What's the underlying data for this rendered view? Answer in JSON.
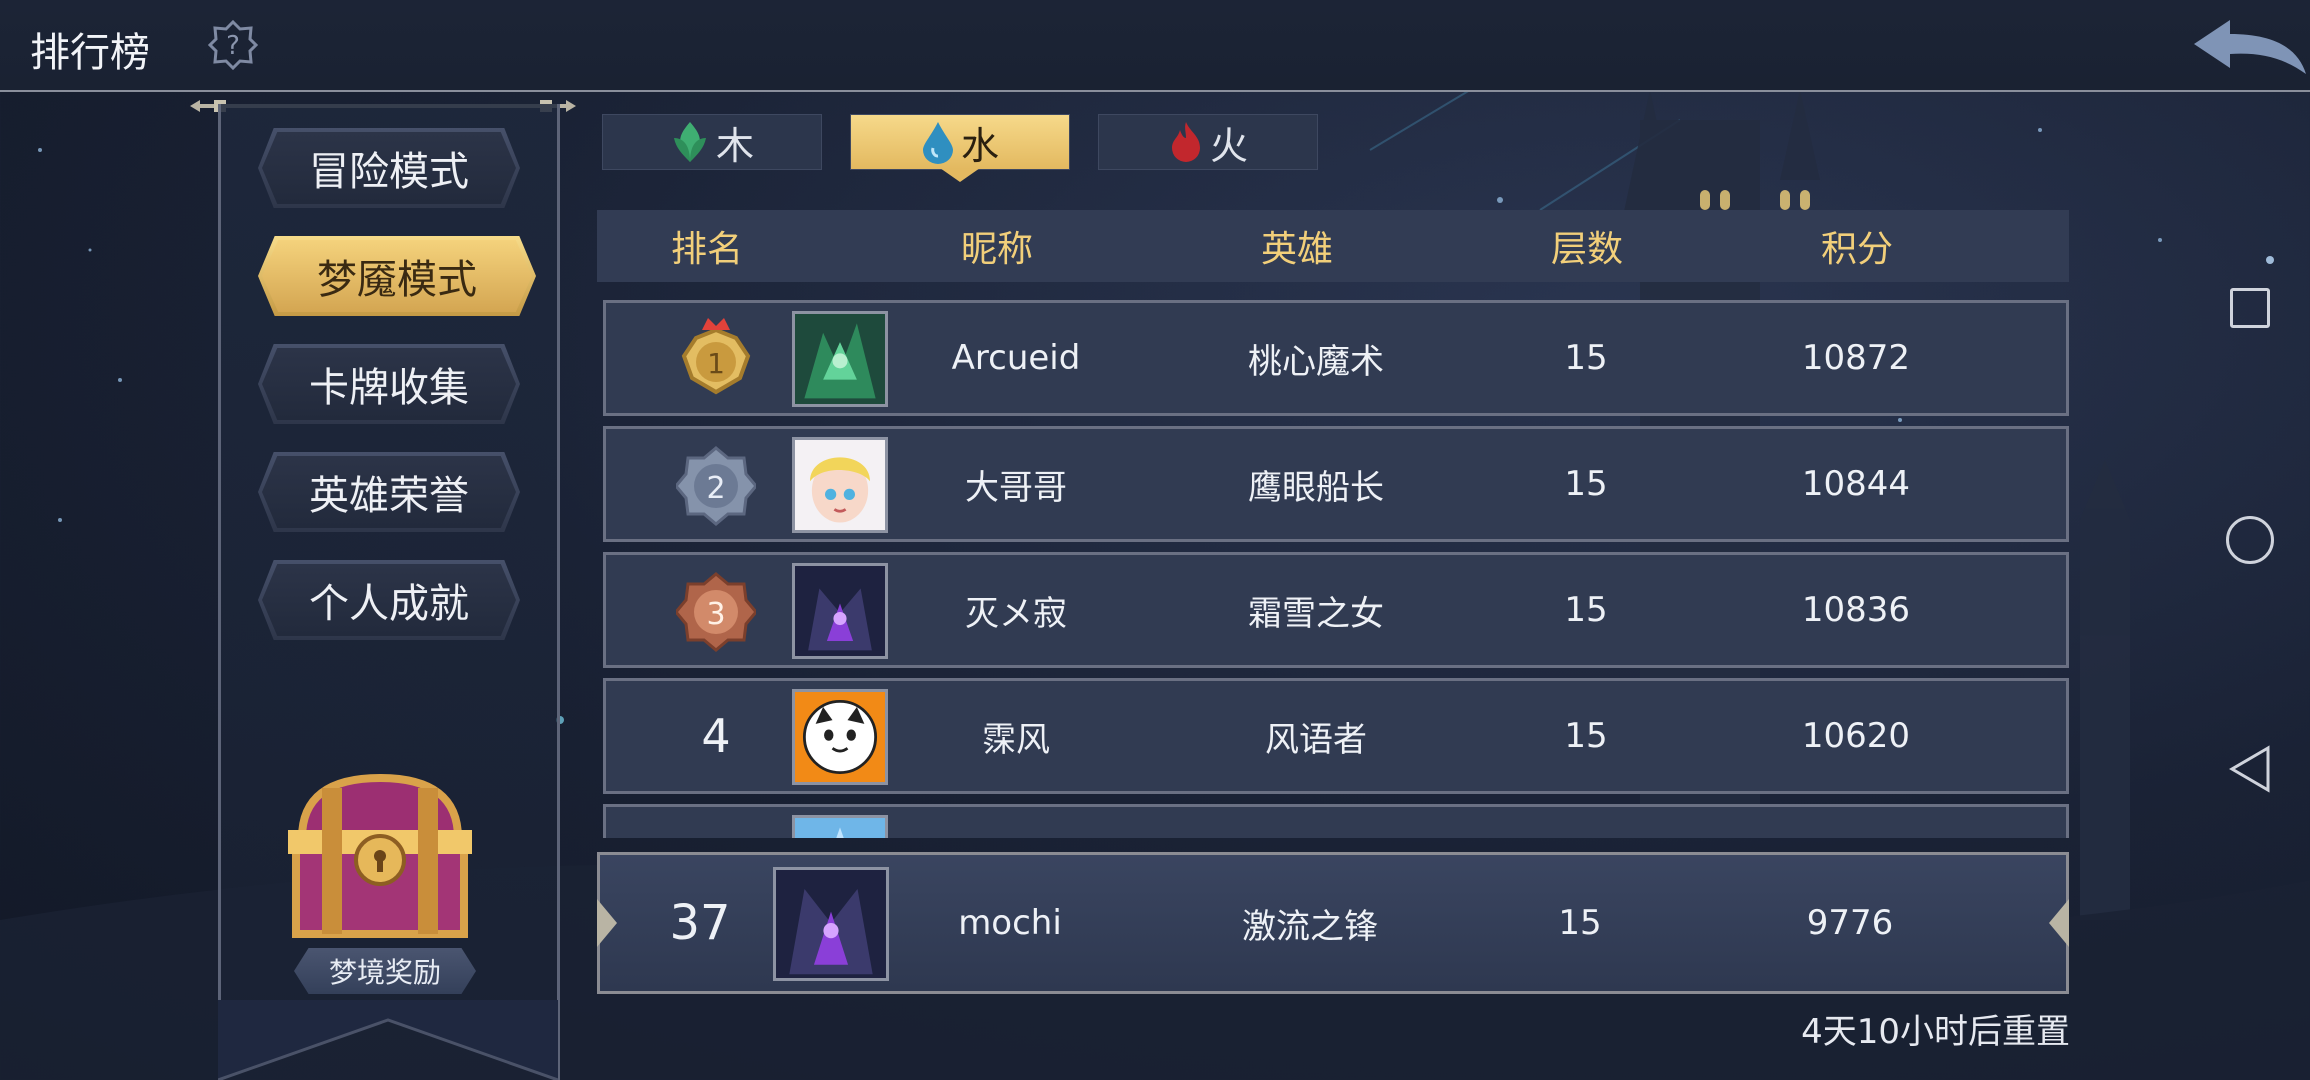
{
  "header": {
    "title": "排行榜"
  },
  "side_menu": {
    "items": [
      {
        "label": "冒险模式",
        "active": false
      },
      {
        "label": "梦魇模式",
        "active": true
      },
      {
        "label": "卡牌收集",
        "active": false
      },
      {
        "label": "英雄荣誉",
        "active": false
      },
      {
        "label": "个人成就",
        "active": false
      }
    ],
    "reward_label": "梦境奖励"
  },
  "tabs": [
    {
      "label": "木",
      "icon": "leaf-icon",
      "active": false
    },
    {
      "label": "水",
      "icon": "water-drop-icon",
      "active": true
    },
    {
      "label": "火",
      "icon": "fire-icon",
      "active": false
    }
  ],
  "table": {
    "headers": [
      "排名",
      "昵称",
      "英雄",
      "层数",
      "积分"
    ],
    "rows": [
      {
        "rank": "1",
        "nickname": "Arcueid",
        "hero": "桃心魔术",
        "floors": "15",
        "score": "10872"
      },
      {
        "rank": "2",
        "nickname": "大哥哥",
        "hero": "鹰眼船长",
        "floors": "15",
        "score": "10844"
      },
      {
        "rank": "3",
        "nickname": "灭メ寂",
        "hero": "霜雪之女",
        "floors": "15",
        "score": "10836"
      },
      {
        "rank": "4",
        "nickname": "霂风",
        "hero": "风语者",
        "floors": "15",
        "score": "10620"
      }
    ]
  },
  "self": {
    "rank": "37",
    "nickname": "mochi",
    "hero": "激流之锋",
    "floors": "15",
    "score": "9776"
  },
  "reset_text": "4天10小时后重置",
  "colors": {
    "accent_gold": "#f2cf7a",
    "panel": "#313b52",
    "background": "#1a2235"
  }
}
